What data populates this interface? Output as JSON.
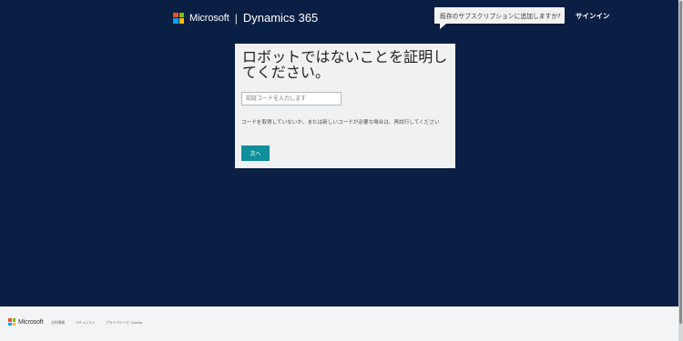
{
  "header": {
    "brand": "Microsoft",
    "separator": "|",
    "product": "Dynamics 365",
    "tooltip": "既存のサブスクリプションに追加しますか?",
    "signin": "サインイン"
  },
  "card": {
    "title": "ロボットではないことを証明してください。",
    "input_placeholder": "認証コードを入力します",
    "help_text": "コードを取得していないか、または新しいコードが必要な場合は、再試行してください",
    "next_button": "次へ"
  },
  "footer": {
    "brand": "Microsoft",
    "links": [
      "法的情報",
      "コミュニティ",
      "プライバシーと Cookie"
    ]
  },
  "colors": {
    "background": "#0a1f44",
    "card": "#f0f1f2",
    "accent": "#0f8f9b",
    "footer": "#f3f4f5"
  },
  "icons": {
    "brand_logo": "microsoft-logo-icon",
    "tooltip_pointer": "tooltip-pointer-icon",
    "scrollbar": "scrollbar-icon"
  }
}
